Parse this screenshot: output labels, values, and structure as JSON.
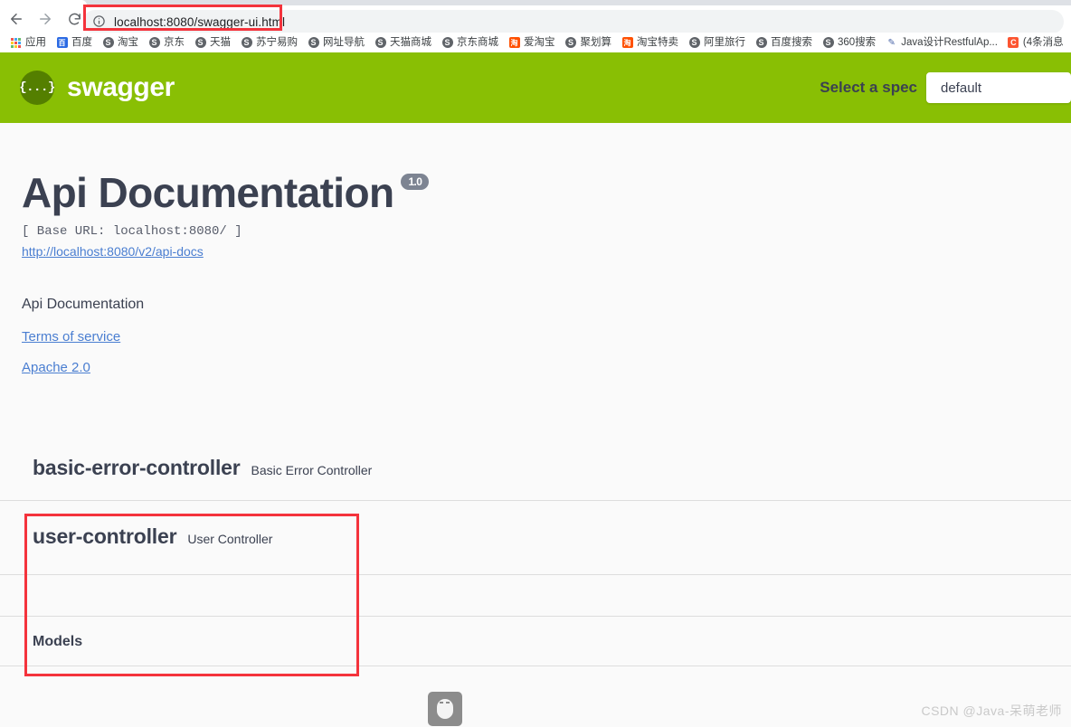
{
  "browser": {
    "nav": {
      "back_icon": "arrow-left-icon",
      "forward_icon": "arrow-right-icon",
      "reload_icon": "reload-icon"
    },
    "omnibox": {
      "info_icon": "page-info-icon",
      "url": "localhost:8080/swagger-ui.html",
      "host": "localhost",
      "path": ":8080/swagger-ui.html"
    },
    "bookmarks": [
      {
        "label": "应用",
        "icon": "apps-grid-icon"
      },
      {
        "label": "百度",
        "icon": "baidu-icon"
      },
      {
        "label": "淘宝",
        "icon": "globe-icon"
      },
      {
        "label": "京东",
        "icon": "globe-icon"
      },
      {
        "label": "天猫",
        "icon": "globe-icon"
      },
      {
        "label": "苏宁易购",
        "icon": "globe-icon"
      },
      {
        "label": "网址导航",
        "icon": "globe-icon"
      },
      {
        "label": "天猫商城",
        "icon": "globe-icon"
      },
      {
        "label": "京东商城",
        "icon": "globe-icon"
      },
      {
        "label": "爱淘宝",
        "icon": "taobao-icon"
      },
      {
        "label": "聚划算",
        "icon": "globe-icon"
      },
      {
        "label": "淘宝特卖",
        "icon": "taobao-icon"
      },
      {
        "label": "阿里旅行",
        "icon": "globe-icon"
      },
      {
        "label": "百度搜索",
        "icon": "globe-icon"
      },
      {
        "label": "360搜索",
        "icon": "globe-icon"
      },
      {
        "label": "Java设计RestfulAp...",
        "icon": "doc-icon"
      },
      {
        "label": "(4条消息",
        "icon": "csdn-icon"
      }
    ]
  },
  "swagger_header": {
    "logo_mark": "{...}",
    "logo_text": "swagger",
    "spec_label": "Select a spec",
    "spec_value": "default",
    "bar_color": "#89bf04"
  },
  "info": {
    "title": "Api Documentation",
    "version": "1.0",
    "base_url": "[ Base URL: localhost:8080/ ]",
    "docs_link": "http://localhost:8080/v2/api-docs",
    "description": "Api Documentation",
    "terms_of_service": "Terms of service",
    "license": "Apache 2.0"
  },
  "tags": [
    {
      "name": "basic-error-controller",
      "description": "Basic Error Controller"
    },
    {
      "name": "user-controller",
      "description": "User Controller"
    }
  ],
  "models_label": "Models",
  "broken_image_icon": "broken-image-icon",
  "annotations": {
    "color": "#f4333c",
    "boxes": [
      {
        "name": "url-highlight"
      },
      {
        "name": "user-controller-highlight"
      }
    ]
  },
  "watermark": "CSDN @Java-呆萌老师"
}
